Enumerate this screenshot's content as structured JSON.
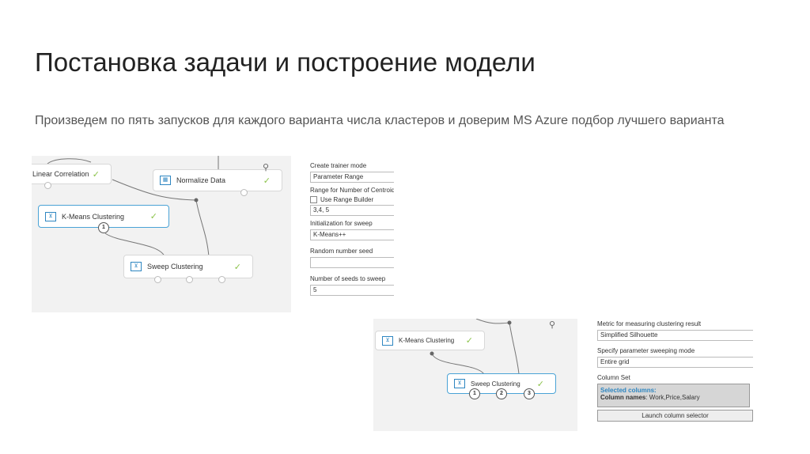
{
  "slide": {
    "title": "Постановка задачи и построение модели",
    "subtitle": "Произведем по пять запусков для каждого варианта числа кластеров и доверим MS Azure подбор лучшего варианта"
  },
  "canvas1": {
    "nodes": {
      "linear": "Linear Correlation",
      "normalize": "Normalize Data",
      "kmeans": "K-Means Clustering",
      "sweep": "Sweep Clustering"
    },
    "port_label": "1"
  },
  "panel1": {
    "create_trainer_label": "Create trainer mode",
    "create_trainer_value": "Parameter Range",
    "range_label": "Range for Number of Centroids",
    "range_builder_label": "Use Range Builder",
    "range_builder_checked": false,
    "range_value": "3,4, 5",
    "init_label": "Initialization for sweep",
    "init_value": "K-Means++",
    "seed_label": "Random number seed",
    "seed_value": "",
    "num_seeds_label": "Number of seeds to sweep",
    "num_seeds_value": "5"
  },
  "canvas2": {
    "nodes": {
      "kmeans": "K-Means Clustering",
      "sweep": "Sweep Clustering"
    },
    "ports": [
      "1",
      "2",
      "3"
    ]
  },
  "panel2": {
    "metric_label": "Metric for measuring clustering result",
    "metric_value": "Simplified Silhouette",
    "mode_label": "Specify parameter sweeping mode",
    "mode_value": "Entire grid",
    "colset_label": "Column Set",
    "selected_label": "Selected columns:",
    "colnames_label": "Column names",
    "colnames_value": ": Work,Price,Salary",
    "launch_label": "Launch column selector"
  },
  "colors": {
    "accent": "#4aa3d6",
    "check": "#8bc34a",
    "canvas_bg": "#f2f2f2"
  }
}
